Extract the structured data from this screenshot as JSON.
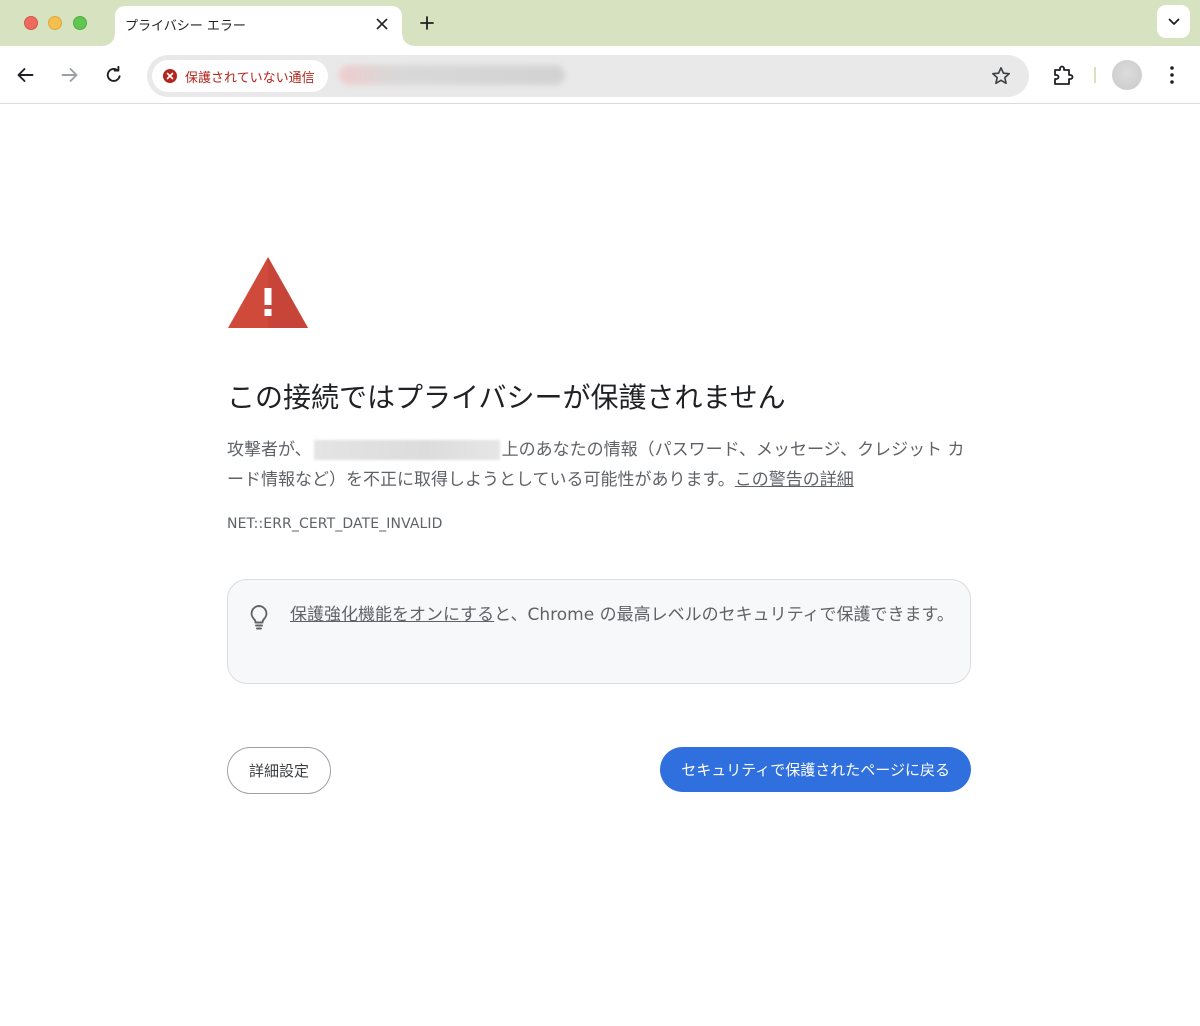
{
  "browser": {
    "tab": {
      "title": "プライバシー エラー"
    },
    "toolbar": {
      "security_chip_label": "保護されていない通信"
    }
  },
  "interstitial": {
    "heading": "この接続ではプライバシーが保護されません",
    "explanation_before_host": "攻撃者が、",
    "explanation_after_host": "上のあなたの情報（パスワード、メッセージ、クレジット カード情報など）を不正に取得しようとしている可能性があります。",
    "details_link": "この警告の詳細",
    "error_code": "NET::ERR_CERT_DATE_INVALID",
    "enhanced_protection": {
      "link": "保護強化機能をオンにする",
      "text": "と、Chrome の最高レベルのセキュリティで保護できます。"
    },
    "advanced_button": "詳細設定",
    "back_button": "セキュリティで保護されたページに戻る"
  },
  "colors": {
    "tabstrip_bg": "#d7e3c0",
    "danger": "#b3261e",
    "warning_triangle": "#d04a3c",
    "primary_button": "#2f6fde"
  },
  "icons": [
    "close-icon",
    "plus-icon",
    "chevron-down-icon",
    "back-arrow-icon",
    "forward-arrow-icon",
    "reload-icon",
    "error-circle-icon",
    "star-icon",
    "extension-icon",
    "kebab-menu-icon",
    "warning-triangle-icon",
    "lightbulb-icon"
  ]
}
